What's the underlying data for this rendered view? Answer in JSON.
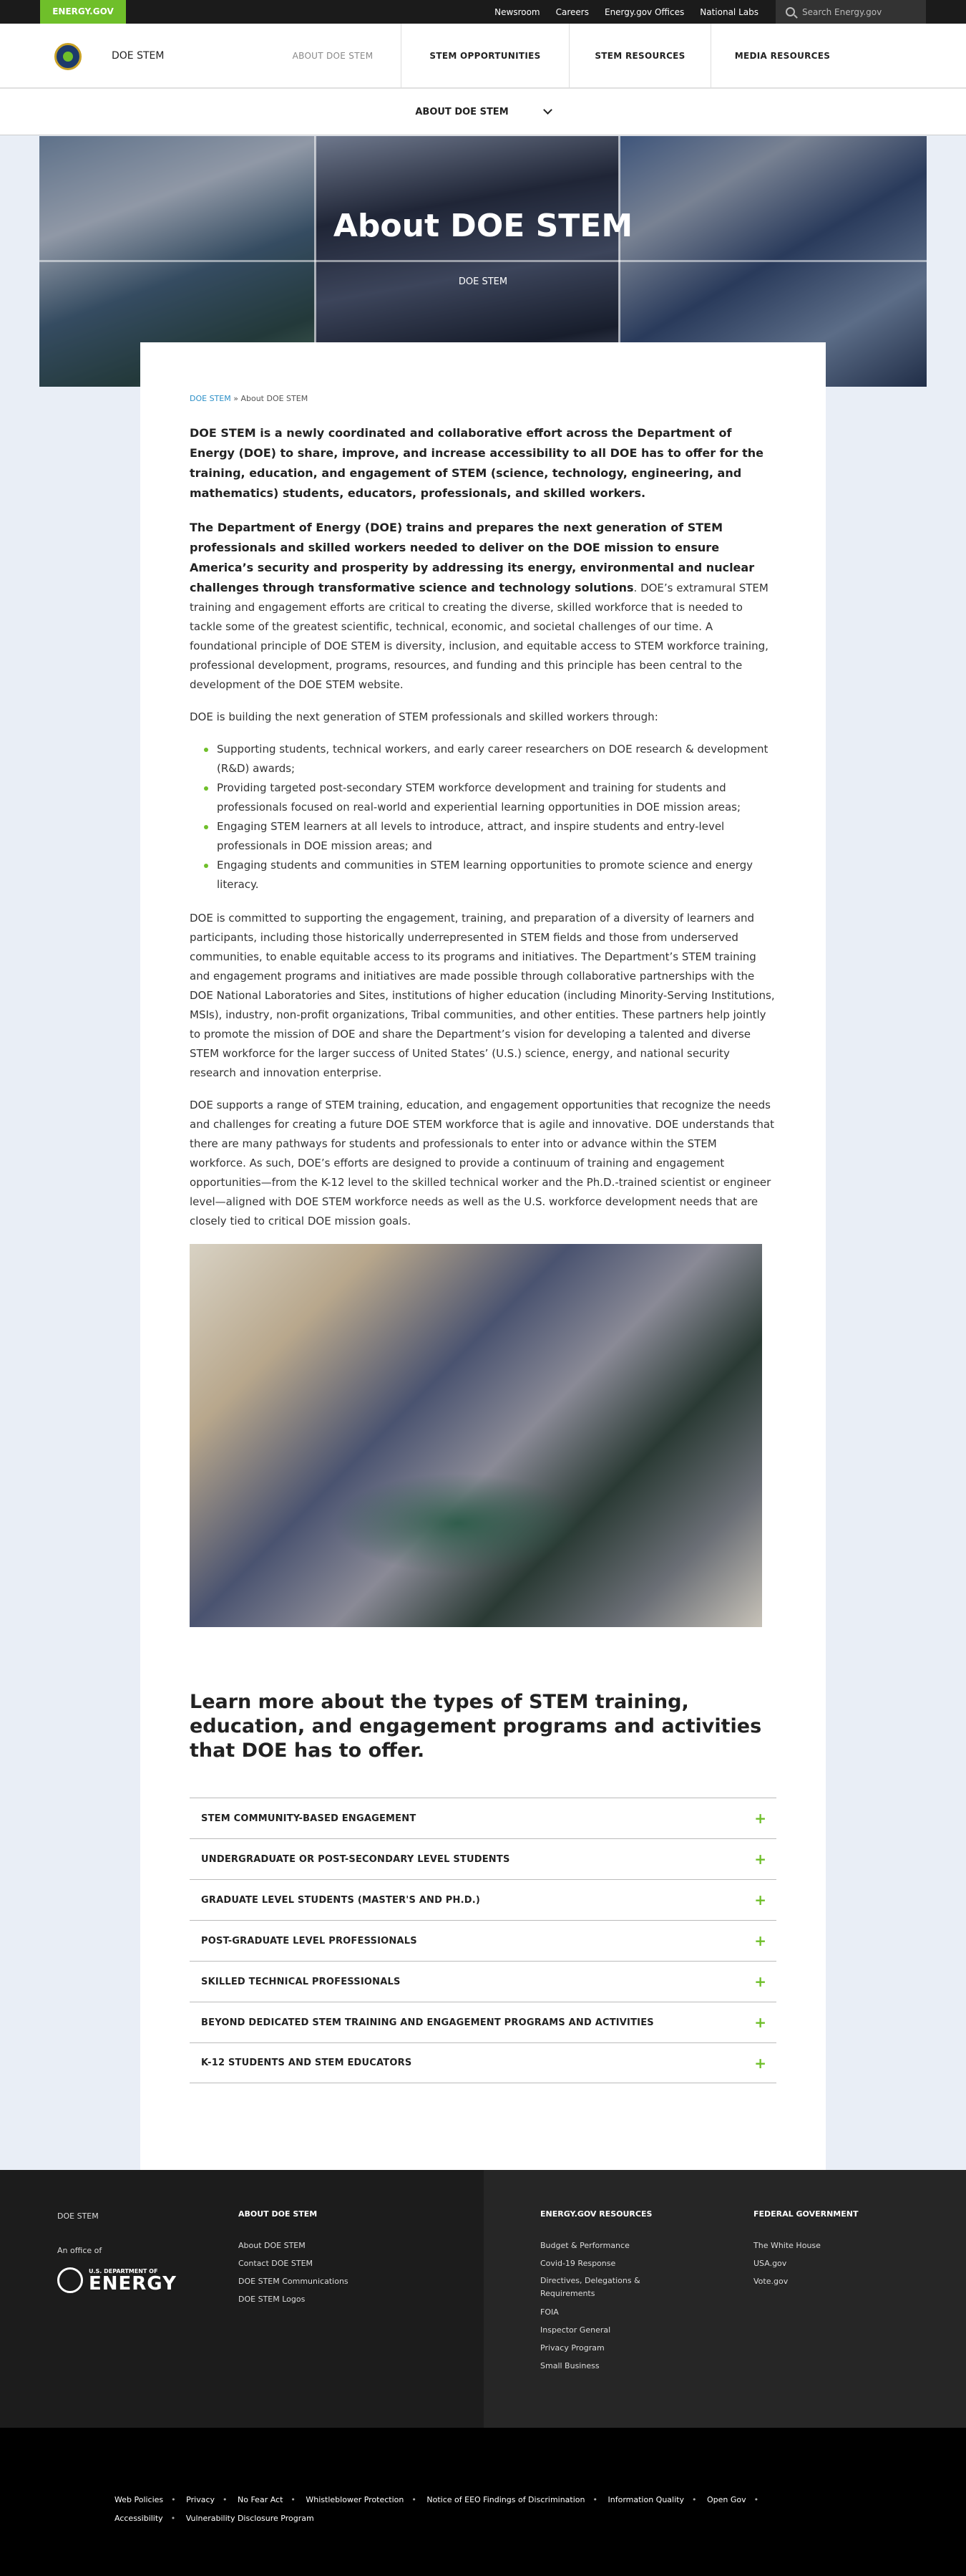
{
  "utility": {
    "brand": "ENERGY.GOV",
    "links": [
      "Newsroom",
      "Careers",
      "Energy.gov Offices",
      "National Labs"
    ],
    "search_placeholder": "Search Energy.gov"
  },
  "header": {
    "site_name": "DOE STEM",
    "nav": [
      "ABOUT DOE STEM",
      "STEM OPPORTUNITIES",
      "STEM RESOURCES",
      "MEDIA RESOURCES"
    ]
  },
  "subnav": {
    "label": "ABOUT DOE STEM"
  },
  "hero": {
    "title": "About DOE STEM",
    "subtitle": "DOE STEM"
  },
  "breadcrumb": {
    "home": "DOE STEM",
    "separator": " » ",
    "current": "About DOE STEM"
  },
  "content": {
    "lead": "DOE STEM is a newly coordinated and collaborative effort across the Department of Energy (DOE) to share, improve, and increase accessibility to all DOE has to offer for the training, education, and engagement of STEM (science, technology, engineering, and mathematics) students, educators, professionals, and skilled workers.",
    "p2_bold": "The Department of Energy (DOE) trains and prepares the next generation of STEM professionals and skilled workers needed to deliver on the DOE mission to ensure America’s security and prosperity by addressing its energy, environmental and nuclear challenges through transformative science and technology solutions",
    "p2_rest": ". DOE’s extramural STEM training and engagement efforts are critical to creating the diverse, skilled workforce that is needed to tackle some of the greatest scientific, technical, economic, and societal challenges of our time. A foundational principle of DOE STEM is diversity, inclusion, and equitable access to STEM workforce training, professional development, programs, resources, and funding and this principle has been central to the development of the DOE STEM website.",
    "p3": "DOE is building the next generation of STEM professionals and skilled workers through:",
    "bullets": [
      "Supporting students, technical workers, and early career researchers on DOE research & development (R&D) awards;",
      "Providing targeted post-secondary STEM workforce development and training for students and professionals focused on real-world and experiential learning opportunities in DOE mission areas;",
      "Engaging STEM learners at all levels to introduce, attract, and inspire students and entry-level professionals in DOE mission areas; and",
      "Engaging students and communities in STEM learning opportunities to promote science and energy literacy."
    ],
    "p4": "DOE is committed to supporting the engagement, training, and preparation of a diversity of learners and participants, including those historically underrepresented in STEM fields and those from underserved communities, to enable equitable access to its programs and initiatives.  The Department’s STEM training and engagement programs and initiatives are made possible through collaborative partnerships with the DOE National Laboratories and Sites, institutions of higher education (including Minority-Serving Institutions, MSIs), industry, non-profit organizations, Tribal communities, and other entities.  These partners help jointly to promote the mission of DOE and share the Department’s vision for developing a talented and diverse STEM workforce for the larger success of United States’ (U.S.) science, energy, and national security research and innovation enterprise.",
    "p5": "DOE supports a range of STEM training, education, and engagement opportunities that recognize the needs and challenges for creating a future DOE STEM workforce that is agile and innovative.  DOE understands that there are many pathways for students and professionals to enter into or advance within the STEM workforce.  As such, DOE’s efforts are designed to provide a continuum of training and engagement opportunities—from the K-12 level to the skilled technical worker and the Ph.D.-trained scientist or engineer level—aligned with DOE STEM workforce needs as well as the U.S. workforce development needs that are closely tied to critical DOE mission goals.",
    "learn_title": "Learn more about the types of STEM training, education, and engagement programs and activities that DOE has to offer."
  },
  "accordion": [
    "STEM COMMUNITY-BASED ENGAGEMENT",
    "UNDERGRADUATE OR POST-SECONDARY LEVEL STUDENTS",
    "GRADUATE LEVEL STUDENTS (MASTER'S AND PH.D.)",
    "POST-GRADUATE LEVEL PROFESSIONALS",
    "SKILLED TECHNICAL PROFESSIONALS",
    "BEYOND DEDICATED STEM TRAINING AND ENGAGEMENT PROGRAMS AND ACTIVITIES",
    "K-12 STUDENTS AND STEM EDUCATORS"
  ],
  "footer": {
    "brand": "DOE STEM",
    "office_of": "An office of",
    "logo_small": "U.S. DEPARTMENT OF",
    "logo_big": "ENERGY",
    "col1_title": "ABOUT DOE STEM",
    "col1_links": [
      "About DOE STEM",
      "Contact DOE STEM",
      "DOE STEM Communications",
      "DOE STEM Logos"
    ],
    "col2_title": "ENERGY.GOV RESOURCES",
    "col2_links": [
      "Budget & Performance",
      "Covid-19 Response",
      "Directives, Delegations & Requirements",
      "FOIA",
      "Inspector General",
      "Privacy Program",
      "Small Business"
    ],
    "col3_title": "FEDERAL GOVERNMENT",
    "col3_links": [
      "The White House",
      "USA.gov",
      "Vote.gov"
    ]
  },
  "legal_links": [
    "Web Policies",
    "Privacy",
    "No Fear Act",
    "Whistleblower Protection",
    "Notice of EEO Findings of Discrimination",
    "Information Quality",
    "Open Gov",
    "Accessibility",
    "Vulnerability Disclosure Program"
  ],
  "colors": {
    "accent_green": "#6fbf2a",
    "link_blue": "#2b8fc7",
    "footer_dark": "#1c1c1c"
  },
  "icons": [
    "search-icon",
    "chevron-down-icon",
    "plus-icon",
    "doe-seal-icon"
  ]
}
